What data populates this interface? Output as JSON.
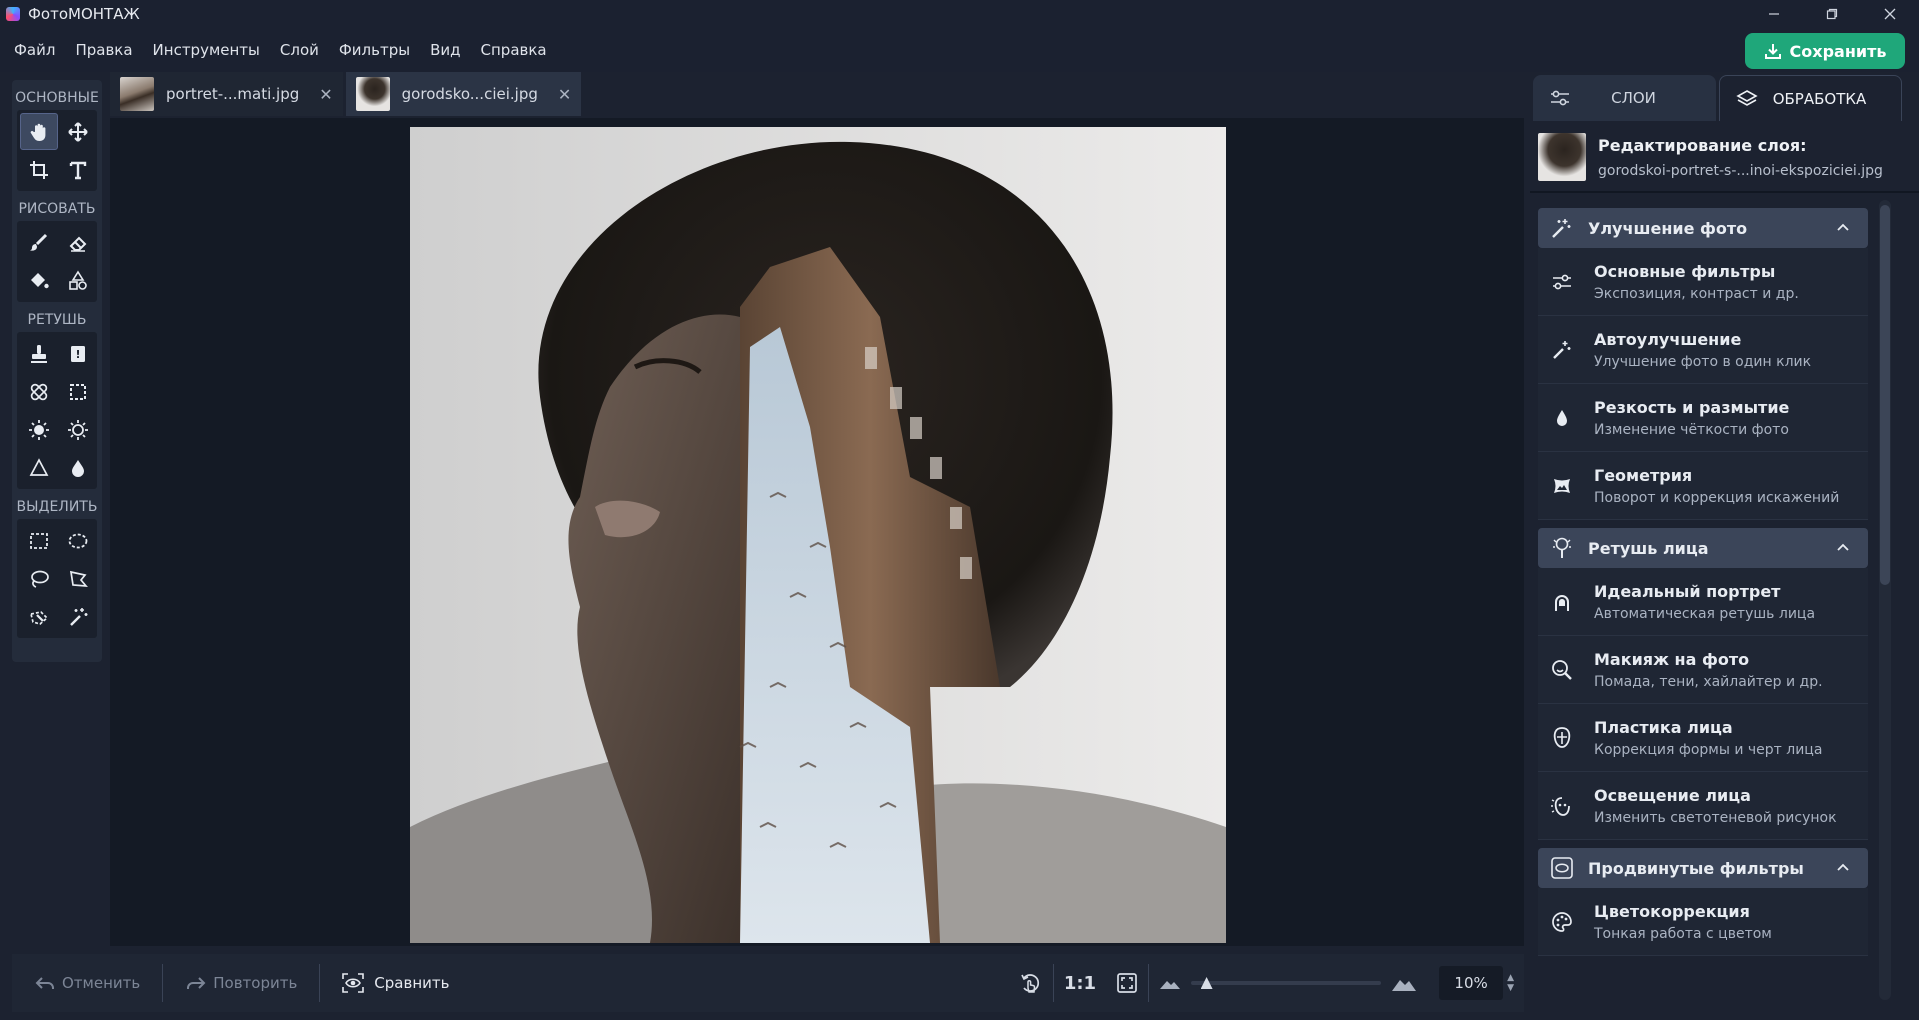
{
  "app": {
    "title": "ФотоМОНТАЖ"
  },
  "menu": [
    "Файл",
    "Правка",
    "Инструменты",
    "Слой",
    "Фильтры",
    "Вид",
    "Справка"
  ],
  "save_label": "Сохранить",
  "toolbox": {
    "sections": [
      "ОСНОВНЫЕ",
      "РИСОВАТЬ",
      "РЕТУШЬ",
      "ВЫДЕЛИТЬ"
    ]
  },
  "doc_tabs": [
    {
      "name": "portret-...mati.jpg",
      "active": false
    },
    {
      "name": "gorodsko...ciei.jpg",
      "active": true
    }
  ],
  "bottom": {
    "undo": "Отменить",
    "redo": "Повторить",
    "compare": "Сравнить",
    "ratio": "1:1",
    "zoom": "10%",
    "zoom_level": 0.05
  },
  "panel": {
    "tabs": [
      "СЛОИ",
      "ОБРАБОТКА"
    ],
    "active_tab": "ОБРАБОТКА",
    "layer_title": "Редактирование слоя:",
    "layer_file": "gorodskoi-portret-s-...inoi-ekspoziciei.jpg",
    "sections": [
      {
        "title": "Улучшение фото",
        "items": [
          {
            "title": "Основные фильтры",
            "sub": "Экспозиция, контраст и др.",
            "icon": "sliders-icon"
          },
          {
            "title": "Автоулучшение",
            "sub": "Улучшение фото в один клик",
            "icon": "magic-wand-icon"
          },
          {
            "title": "Резкость и размытие",
            "sub": "Изменение чёткости фото",
            "icon": "drop-icon"
          },
          {
            "title": "Геометрия",
            "sub": "Поворот и коррекция искажений",
            "icon": "geometry-icon"
          }
        ]
      },
      {
        "title": "Ретушь лица",
        "items": [
          {
            "title": "Идеальный портрет",
            "sub": "Автоматическая ретушь лица",
            "icon": "portrait-icon"
          },
          {
            "title": "Макияж на фото",
            "sub": "Помада, тени, хайлайтер и др.",
            "icon": "makeup-icon"
          },
          {
            "title": "Пластика лица",
            "sub": "Коррекция формы и черт лица",
            "icon": "face-shape-icon"
          },
          {
            "title": "Освещение лица",
            "sub": "Изменить светотеневой рисунок",
            "icon": "face-light-icon"
          }
        ]
      },
      {
        "title": "Продвинутые фильтры",
        "items": [
          {
            "title": "Цветокоррекция",
            "sub": "Тонкая работа с цветом",
            "icon": "palette-icon"
          }
        ]
      }
    ]
  },
  "colors": {
    "accent": "#1fa77a",
    "panel": "#1c2230",
    "section": "#3b4559"
  }
}
